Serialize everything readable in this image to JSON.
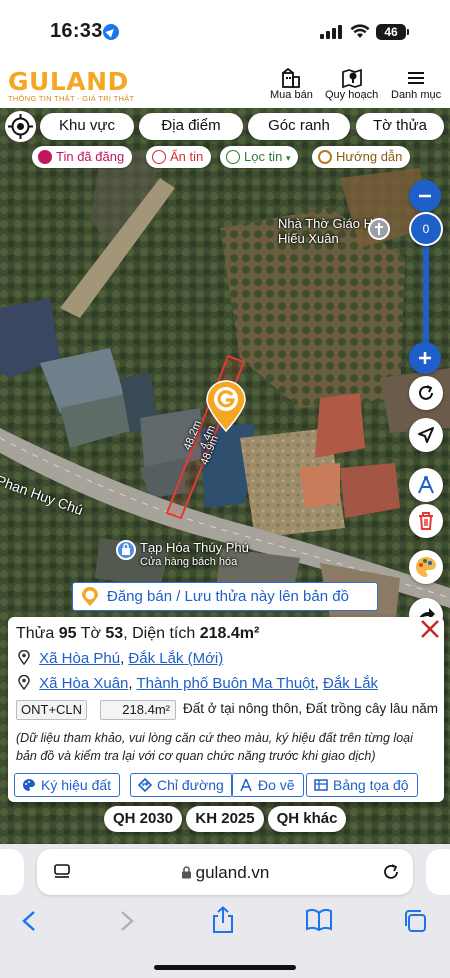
{
  "status_bar": {
    "time": "16:33",
    "battery": "46"
  },
  "app": {
    "logo": "GULAND",
    "tagline": "THÔNG TIN THẬT - GIÁ TRỊ THẬT",
    "nav": [
      {
        "label": "Mua bán",
        "icon": "building-icon"
      },
      {
        "label": "Quy hoạch",
        "icon": "map-pin-icon"
      },
      {
        "label": "Danh mục",
        "icon": "menu-icon"
      }
    ]
  },
  "map": {
    "filter_tabs": [
      "Khu vực",
      "Địa điểm",
      "Góc ranh",
      "Tờ thửa"
    ],
    "tags": [
      {
        "label": "Tin đã đăng",
        "color": "#c2185b",
        "icon": "post-icon"
      },
      {
        "label": "Ẩn tin",
        "color": "#d32f2f",
        "icon": "hide-icon"
      },
      {
        "label": "Lọc tin",
        "color": "#2e7d32",
        "icon": "filter-icon"
      },
      {
        "label": "Hướng dẫn",
        "color": "#b7791f",
        "icon": "guide-icon"
      }
    ],
    "zoom_value": "0",
    "labels": {
      "church": "Nhà Thờ Giáo Họ Hiếu Xuân",
      "street": "Phan Huy Chú",
      "shop_name": "Tạp Hóa Thúy Phú",
      "shop_sub": "Cửa hàng bách hóa",
      "dim_left": "48.2m",
      "dim_top": "4.4m",
      "dim_right": "48.9m"
    },
    "register_label": "Đăng bán / Lưu thửa này lên bản đồ"
  },
  "parcel": {
    "thua_label": "Thửa",
    "thua": "95",
    "to_label": "Tờ",
    "to": "53",
    "area_label": "Diện tích",
    "area": "218.4m²",
    "new_address": {
      "ward": "Xã Hòa Phú",
      "province": "Đắk Lắk (Mới)"
    },
    "old_address": {
      "ward": "Xã Hòa Xuân",
      "city": "Thành phố Buôn Ma Thuột",
      "province": "Đắk Lắk"
    },
    "land_type": "ONT+CLN",
    "land_area": "218.4m²",
    "land_desc": "Đất ở tại nông thôn, Đất trồng cây lâu năm",
    "note": "(Dữ liệu tham khảo, vui lòng căn cứ theo màu, ký hiệu đất trên từng loại bản đồ và kiểm tra lại với cơ quan chức năng trước khi giao dịch)",
    "actions": [
      {
        "label": "Ký hiệu đất",
        "icon": "palette-icon"
      },
      {
        "label": "Chỉ đường",
        "icon": "directions-icon"
      },
      {
        "label": "Đo vẽ",
        "icon": "measure-icon"
      },
      {
        "label": "Bảng tọa độ",
        "icon": "table-icon"
      }
    ]
  },
  "plan_buttons": [
    "QH 2030",
    "KH 2025",
    "QH khác"
  ],
  "browser": {
    "url": "guland.vn"
  },
  "colors": {
    "brand": "#f5a623",
    "link": "#1f5fc9",
    "zoom": "#1f5fc9",
    "parcel_outline": "#e53935"
  }
}
